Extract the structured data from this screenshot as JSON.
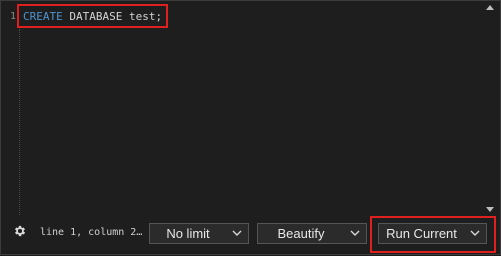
{
  "editor": {
    "line_number": "1",
    "code_keyword": "CREATE",
    "code_rest": " DATABASE test;"
  },
  "status": {
    "position_text": "line 1, column 2…"
  },
  "toolbar": {
    "limit_selected": "No limit",
    "beautify_label": "Beautify",
    "run_label": "Run Current"
  },
  "icons": {
    "settings": "gear-icon",
    "dropdown": "chevron-down-icon"
  },
  "colors": {
    "background": "#1e1e1e",
    "keyword": "#4e94ce",
    "highlight": "#e0201f"
  }
}
